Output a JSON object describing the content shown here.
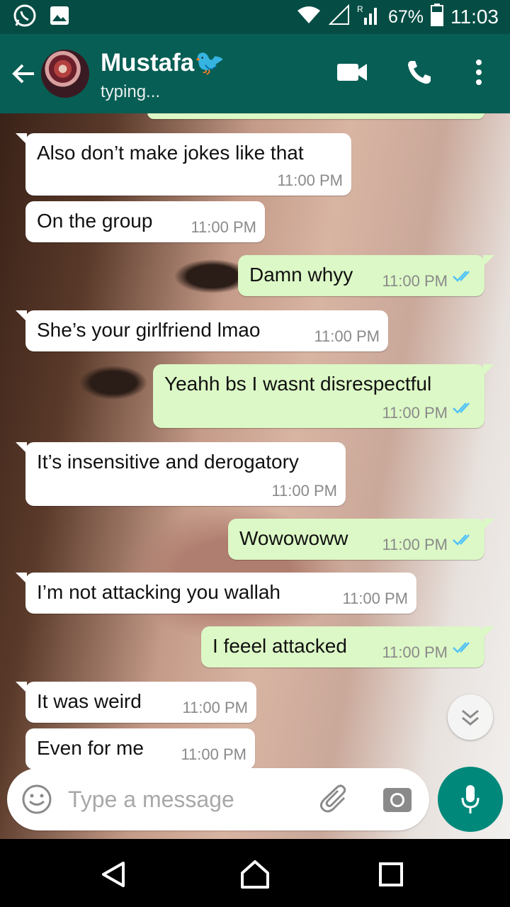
{
  "status_bar": {
    "battery": "67%",
    "time": "11:03",
    "icons": [
      "whatsapp-icon",
      "gallery-icon",
      "wifi-icon",
      "signal-icon",
      "roaming-signal-icon",
      "battery-icon"
    ]
  },
  "header": {
    "contact_name": "Mustafa",
    "contact_emoji": "🐦",
    "status": "typing...",
    "icons": [
      "back-arrow-icon",
      "video-call-icon",
      "voice-call-icon",
      "more-options-icon"
    ]
  },
  "messages": [
    {
      "dir": "in",
      "text": "Also don’t make jokes like that",
      "time": "11:00 PM"
    },
    {
      "dir": "in",
      "text": "On the group",
      "time": "11:00 PM"
    },
    {
      "dir": "out",
      "text": "Damn whyy",
      "time": "11:00 PM",
      "read": true
    },
    {
      "dir": "in",
      "text": "She’s your girlfriend lmao",
      "time": "11:00 PM"
    },
    {
      "dir": "out",
      "text": "Yeahh bs I wasnt disrespectful",
      "time": "11:00 PM",
      "read": true
    },
    {
      "dir": "in",
      "text": "It’s insensitive and derogatory",
      "time": "11:00 PM"
    },
    {
      "dir": "out",
      "text": "Wowowoww",
      "time": "11:00 PM",
      "read": true
    },
    {
      "dir": "in",
      "text": "I’m not attacking you wallah",
      "time": "11:00 PM"
    },
    {
      "dir": "out",
      "text": "I feeel attacked",
      "time": "11:00 PM",
      "read": true
    },
    {
      "dir": "in",
      "text": "It was weird",
      "time": "11:00 PM"
    },
    {
      "dir": "in",
      "text": "Even for me",
      "time": "11:00 PM"
    }
  ],
  "composer": {
    "placeholder": "Type a message",
    "icons": [
      "emoji-icon",
      "attach-icon",
      "camera-icon",
      "mic-icon"
    ]
  },
  "colors": {
    "header": "#075e54",
    "status_bar": "#054d44",
    "outgoing_bubble": "#dcf8c6",
    "incoming_bubble": "#ffffff",
    "read_ticks": "#4fc3f7",
    "mic_button": "#00897b"
  }
}
